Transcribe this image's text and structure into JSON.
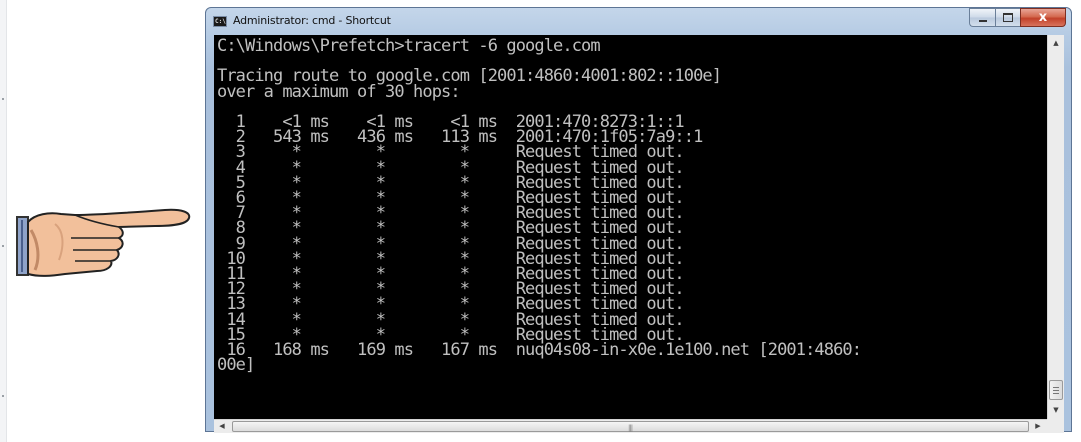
{
  "window": {
    "title": "Administrator: cmd - Shortcut",
    "icon": "cmd-icon",
    "icon_text": "C:\\",
    "controls": {
      "minimize": "minimize-icon",
      "maximize": "maximize-icon",
      "close": "close-icon",
      "close_glyph": "x"
    }
  },
  "console": {
    "lines": [
      "C:\\Windows\\Prefetch>tracert -6 google.com",
      "",
      "Tracing route to google.com [2001:4860:4001:802::100e]",
      "over a maximum of 30 hops:",
      "",
      "  1    <1 ms    <1 ms    <1 ms  2001:470:8273:1::1",
      "  2   543 ms   436 ms   113 ms  2001:470:1f05:7a9::1",
      "  3     *        *        *     Request timed out.",
      "  4     *        *        *     Request timed out.",
      "  5     *        *        *     Request timed out.",
      "  6     *        *        *     Request timed out.",
      "  7     *        *        *     Request timed out.",
      "  8     *        *        *     Request timed out.",
      "  9     *        *        *     Request timed out.",
      " 10     *        *        *     Request timed out.",
      " 11     *        *        *     Request timed out.",
      " 12     *        *        *     Request timed out.",
      " 13     *        *        *     Request timed out.",
      " 14     *        *        *     Request timed out.",
      " 15     *        *        *     Request timed out.",
      " 16   168 ms   169 ms   167 ms  nuq04s08-in-x0e.1e100.net [2001:4860:",
      "00e]"
    ]
  },
  "scrollbars": {
    "up": "▲",
    "down": "▼",
    "left": "◀",
    "right": "▶",
    "grip": "|||"
  },
  "annotation": {
    "icon": "pointing-hand-icon"
  },
  "colors": {
    "console_bg": "#000000",
    "console_text": "#c0c0c0",
    "frame": "#b4cae3",
    "close_button": "#c2412a"
  }
}
